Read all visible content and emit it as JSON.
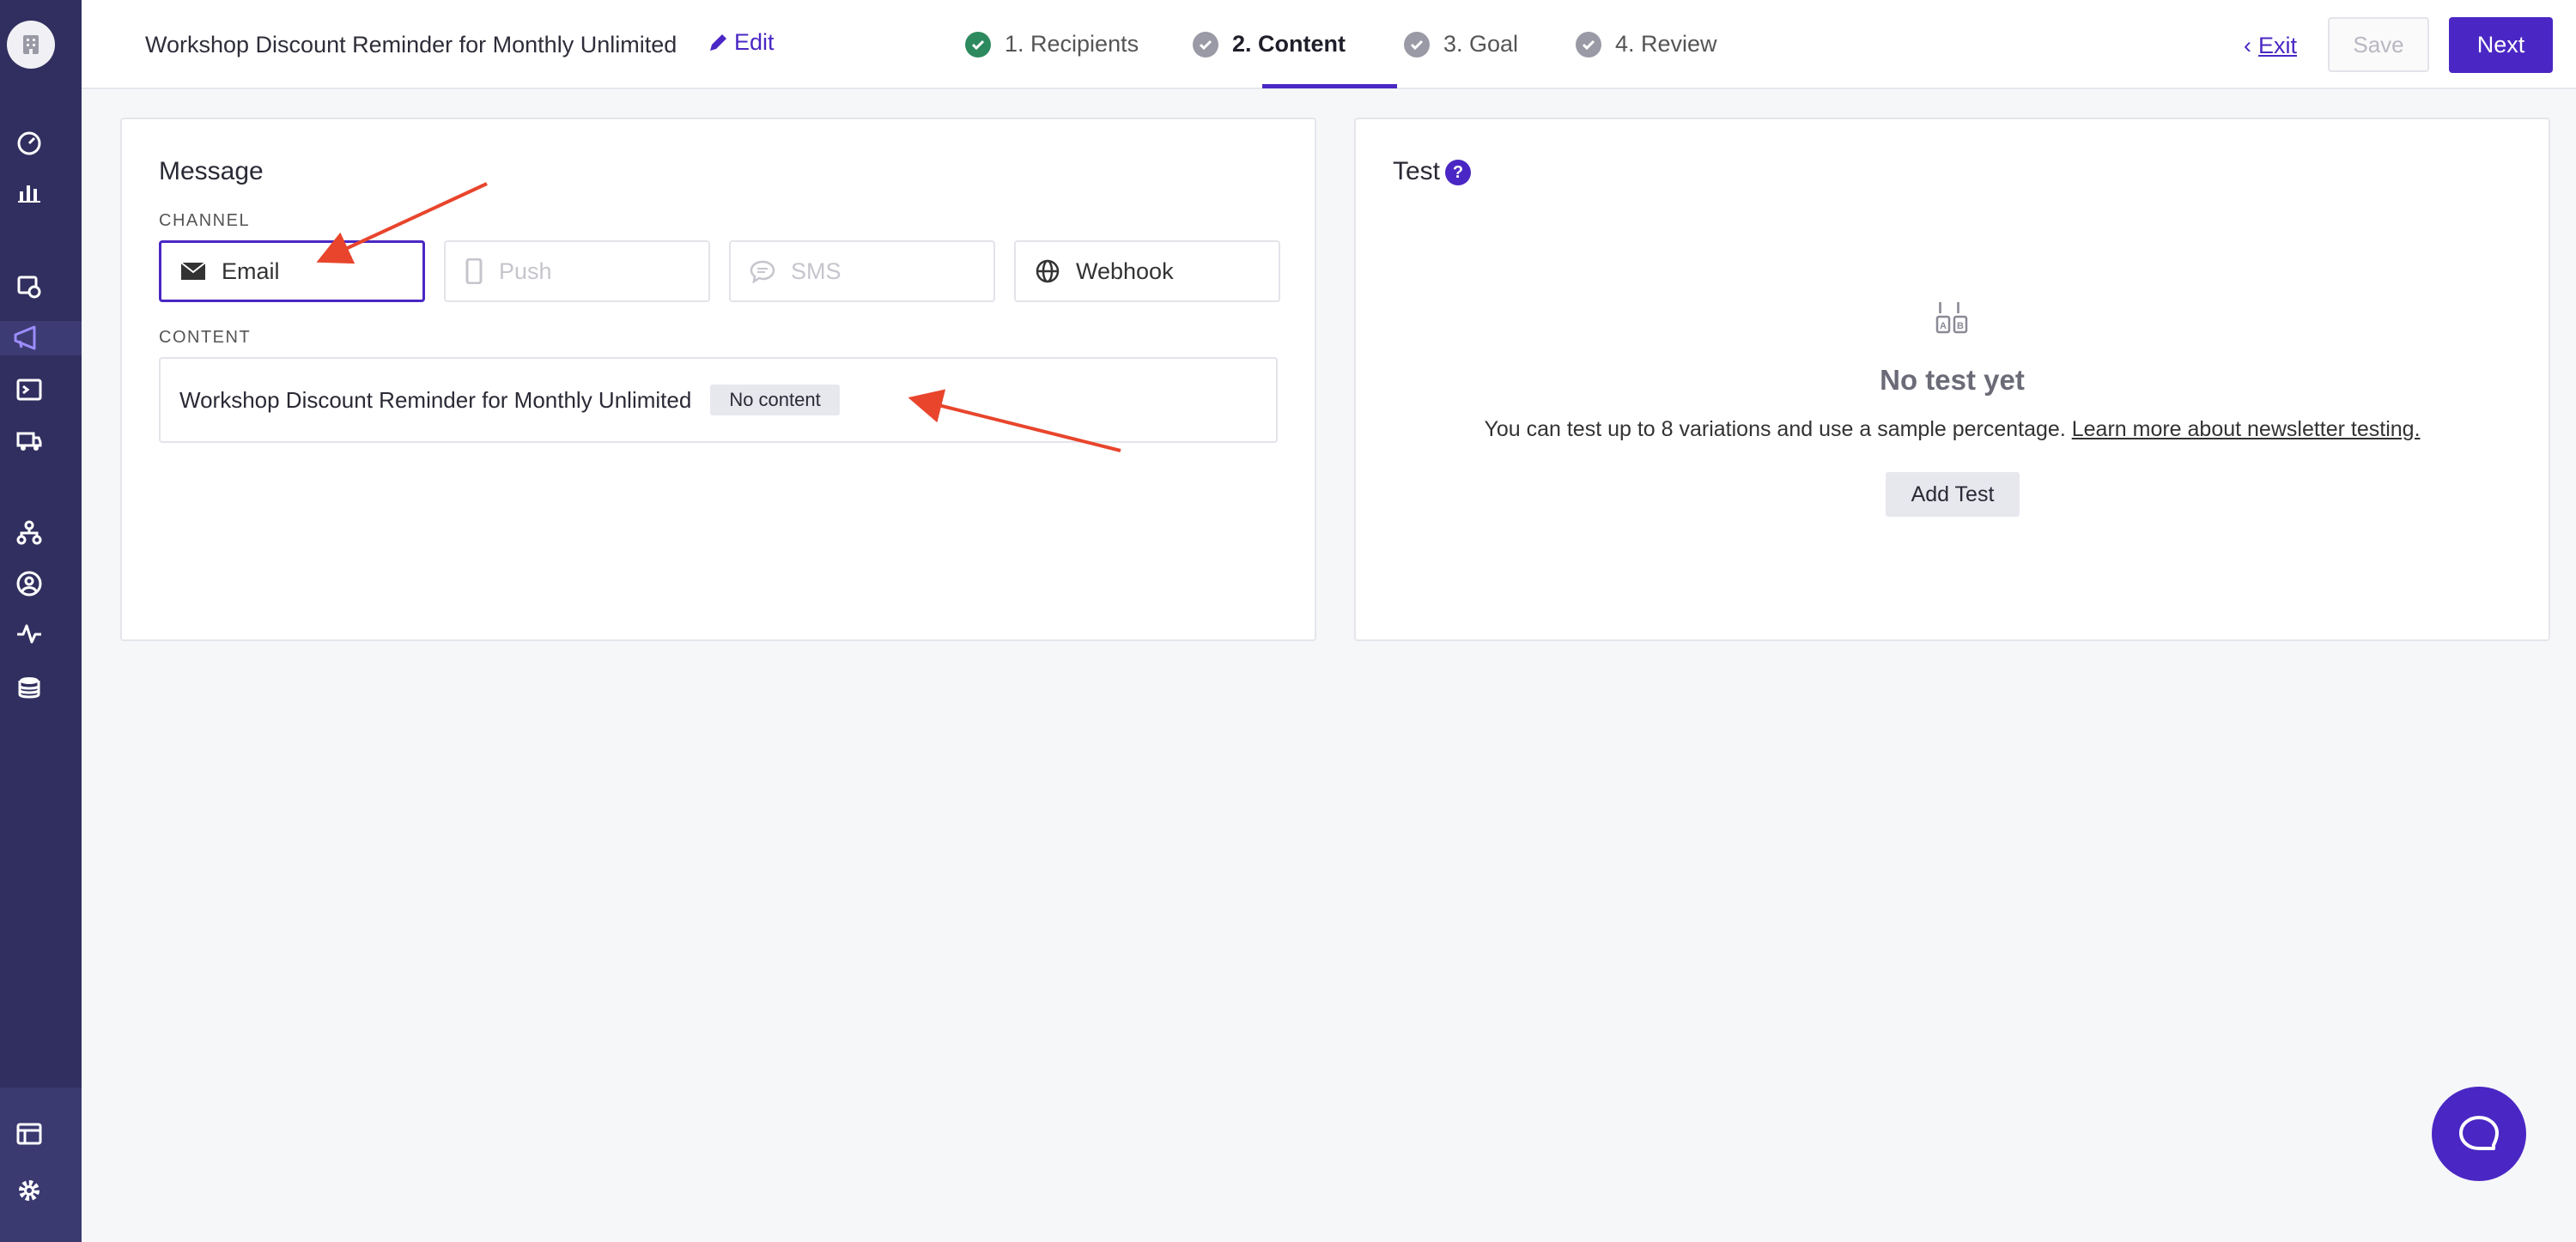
{
  "header": {
    "campaign_title": "Workshop Discount Reminder for Monthly Unlimited",
    "edit_label": "Edit",
    "steps": [
      {
        "label": "1. Recipients",
        "state": "done"
      },
      {
        "label": "2. Content",
        "state": "active"
      },
      {
        "label": "3. Goal",
        "state": "pending"
      },
      {
        "label": "4. Review",
        "state": "pending"
      }
    ],
    "exit_label": "Exit",
    "save_label": "Save",
    "next_label": "Next"
  },
  "sidebar": {
    "icons": [
      "logo-icon",
      "dashboard-icon",
      "analytics-icon",
      "journeys-icon",
      "campaigns-icon",
      "terminal-icon",
      "truck-icon",
      "org-chart-icon",
      "profile-icon",
      "activity-icon",
      "database-icon",
      "table-icon",
      "settings-icon"
    ],
    "active": "campaigns-icon"
  },
  "message": {
    "heading": "Message",
    "channel_label": "CHANNEL",
    "channels": [
      {
        "label": "Email",
        "icon": "envelope-icon",
        "state": "selected"
      },
      {
        "label": "Push",
        "icon": "phone-icon",
        "state": "disabled"
      },
      {
        "label": "SMS",
        "icon": "chat-bubble-icon",
        "state": "disabled"
      },
      {
        "label": "Webhook",
        "icon": "globe-icon",
        "state": "enabled"
      }
    ],
    "content_label": "CONTENT",
    "content_name": "Workshop Discount Reminder for Monthly Unlimited",
    "content_badge": "No content"
  },
  "test": {
    "heading": "Test",
    "help_icon": "?",
    "empty_title": "No test yet",
    "empty_description": "You can test up to 8 variations and use a sample percentage.",
    "learn_more_link": "Learn more about newsletter testing.",
    "add_test_label": "Add Test"
  },
  "colors": {
    "accent": "#4a27c4",
    "sidebar": "#302f5f",
    "success": "#2d8a5f",
    "annotation": "#e8452c"
  }
}
